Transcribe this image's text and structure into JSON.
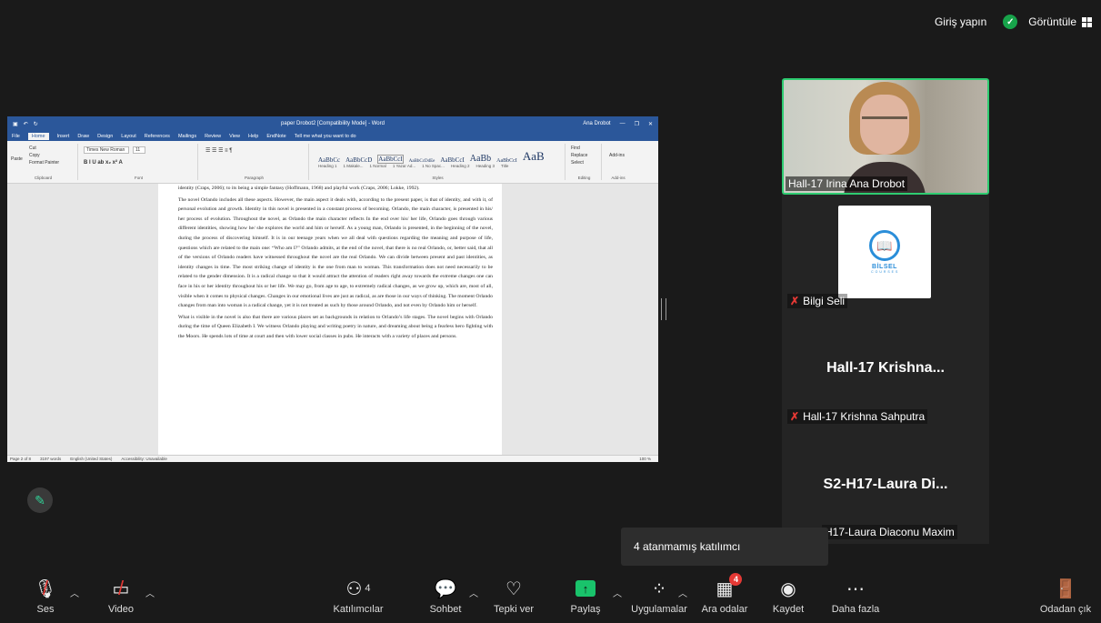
{
  "topbar": {
    "signin": "Giriş yapın",
    "view": "Görüntüle"
  },
  "word": {
    "title": "paper Drobot2 [Compatibility Mode] - Word",
    "user": "Ana Drobot",
    "tabs": [
      "File",
      "Home",
      "Insert",
      "Draw",
      "Design",
      "Layout",
      "References",
      "Mailings",
      "Review",
      "View",
      "Help",
      "EndNote"
    ],
    "tell_me": "Tell me what you want to do",
    "ribbon": {
      "clipboard": "Clipboard",
      "font": "Font",
      "paragraph": "Paragraph",
      "styles": "Styles",
      "editing": "Editing",
      "addins": "Add-ins",
      "paste": "Paste",
      "cut": "Cut",
      "copy": "Copy",
      "format_painter": "Format Painter",
      "font_name": "Times New Roman",
      "font_size": "11",
      "style_names": [
        "AaBbCc",
        "AaBbCcD",
        "AaBbCcI",
        "AaBbCcDdEe",
        "AaBbCcI",
        "AaBb",
        "AaBbCcI",
        "AaB"
      ],
      "style_labels": [
        "Heading 1",
        "1 Makale...",
        "1 Normal",
        "1 Yazar Ad...",
        "1 No Spac...",
        "Heading 2",
        "Heading 3",
        "Title"
      ],
      "find": "Find",
      "replace": "Replace",
      "select": "Select",
      "addins_btn": "Add-ins"
    },
    "page_paragraphs": [
      "identity (Craps, 2006); to its being a simple fantasy (Hoffmann, 1968) and playful work (Craps, 2006; Lokke, 1992).",
      "The novel Orlando includes all these aspects. However, the main aspect it deals with, according to the present paper, is that of identity, and with it, of personal evolution and growth. Identity in this novel is presented in a constant process of becoming. Orlando, the main character, is presented in his/ her process of evolution. Throughout the novel, as Orlando the main character reflects In the end over his/ her life, Orlando goes through various different identities, showing how he/ she explores the world and him or herself. As a young man, Orlando is presented, in the beginning of the novel, during the process of discovering himself. It is in our teenage years when we all deal with questions regarding the meaning and purpose of life, questions which are related to the main one: “Who am I?” Orlando admits, at the end of the novel, that there is no real Orlando, or, better said, that all of the versions of Orlando readers have witnessed throughout the novel are the real Orlando. We can divide between present and past identities, as identity changes in time. The most striking change of identity is the one from man to woman. This transformation does not need necessarily to be related to the gender dimension. It is a radical change so that it would attract the attention of readers right away towards the extreme changes one can face in his or her identity throughout his or her life. We may go, from age to age, to extremely radical changes, as we grow up, which are, most of all, visible when it comes to physical changes. Changes in our emotional lives are just as radical, as are those in our ways of thinking. The moment Orlando changes from man into woman is a radical change, yet it is not treated as such by those around Orlando, and not even by Orlando him or herself.",
      "What is visible in the novel is also that there are various places set as backgrounds in relation to Orlando’s life stages. The novel begins with Orlando during the time of Queen Elizabeth I. We witness Orlando playing and writing poetry in nature, and dreaming about being a fearless hero fighting with the Moors. He spends lots of time at court and then with lower social classes in pubs. He interacts with a variety of places and persons."
    ],
    "status": {
      "page": "Page 2 of 8",
      "words": "3197 words",
      "lang": "English (United States)",
      "access": "Accessibility: Unavailable",
      "zoom": "100 %"
    }
  },
  "participants": {
    "video_name": "Hall-17 Irina Ana Drobot",
    "bilgi": "Bilgi Seli",
    "logo_text": "BİLSEL",
    "logo_sub": "C O U R S E S",
    "krishna_big": "Hall-17  Krishna...",
    "krishna_full": "Hall-17 Krishna Sahputra",
    "laura_big": "S2-H17-Laura  Di...",
    "laura_full": "H17-Laura Diaconu Maxim"
  },
  "tooltip": "4 atanmamış katılımcı",
  "toolbar": {
    "audio": "Ses",
    "video": "Video",
    "participants": "Katılımcılar",
    "participants_count": "4",
    "chat": "Sohbet",
    "react": "Tepki ver",
    "share": "Paylaş",
    "apps": "Uygulamalar",
    "breakout": "Ara odalar",
    "breakout_badge": "4",
    "record": "Kaydet",
    "more": "Daha fazla",
    "leave": "Odadan çık"
  }
}
